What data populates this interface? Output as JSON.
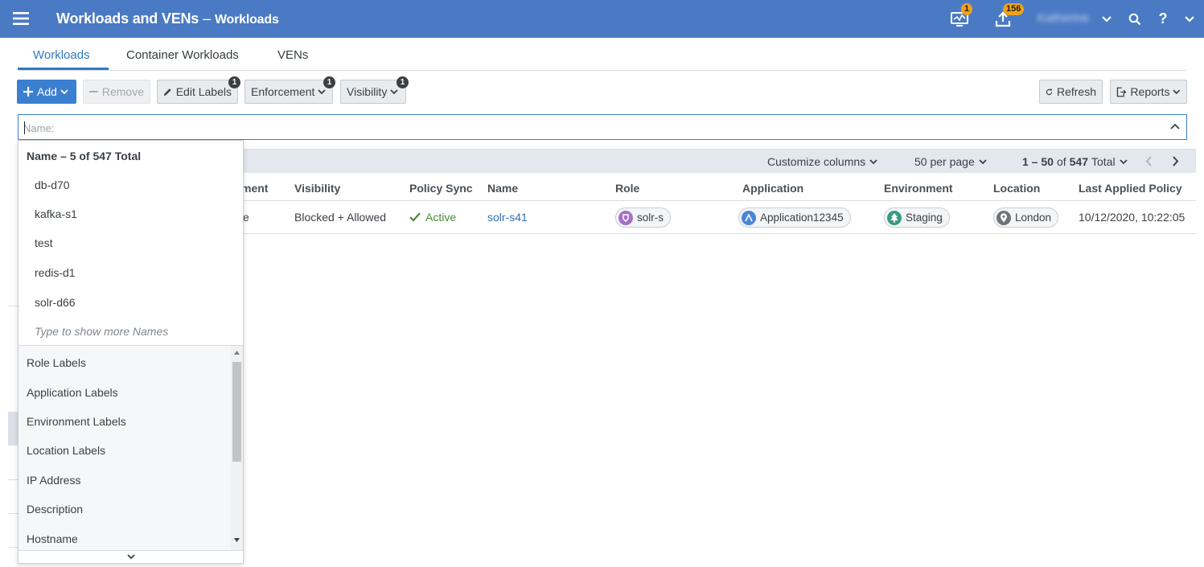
{
  "header": {
    "title": "Workloads and VENs",
    "separator": "–",
    "subtitle": "Workloads",
    "notifications_count": "1",
    "uploads_count": "156",
    "user_name": "Katherine"
  },
  "tabs": [
    {
      "label": "Workloads",
      "active": true
    },
    {
      "label": "Container Workloads"
    },
    {
      "label": "VENs"
    }
  ],
  "toolbar": {
    "add_label": "Add",
    "remove_label": "Remove",
    "edit_labels_label": "Edit Labels",
    "edit_labels_badge": "1",
    "enforcement_label": "Enforcement",
    "enforcement_badge": "1",
    "visibility_label": "Visibility",
    "visibility_badge": "1",
    "refresh_label": "Refresh",
    "reports_label": "Reports"
  },
  "search": {
    "placeholder": "Name:",
    "value": ""
  },
  "pagination": {
    "customize_label": "Customize columns",
    "per_page_label": "50 per page",
    "range": "1 – 50",
    "of_label": "of",
    "total": "547",
    "total_label": "Total"
  },
  "table": {
    "columns": [
      "ment",
      "Visibility",
      "Policy Sync",
      "Name",
      "Role",
      "Application",
      "Environment",
      "Location",
      "Last Applied Policy"
    ],
    "rows": [
      {
        "enforcement": "e",
        "visibility": "Blocked + Allowed",
        "policy_sync": "Active",
        "name": "solr-s41",
        "role": "solr-s",
        "application": "Application12345",
        "environment": "Staging",
        "location": "London",
        "last_applied": "10/12/2020, 10:22:05"
      }
    ]
  },
  "dropdown": {
    "title": "Name – 5 of 547 Total",
    "items": [
      "db-d70",
      "kafka-s1",
      "test",
      "redis-d1",
      "solr-d66"
    ],
    "hint": "Type to show more Names",
    "categories": [
      "Role Labels",
      "Application Labels",
      "Environment Labels",
      "Location Labels",
      "IP Address",
      "Description",
      "Hostname"
    ]
  },
  "colors": {
    "header_bg": "#4a7ac4",
    "primary": "#3b7fd0",
    "link": "#2f6fb3",
    "active_green": "#4b8a3a",
    "badge_orange": "#f0a21a",
    "role_icon": "#a570c8",
    "app_icon": "#4a86d4",
    "env_icon": "#3a9a86",
    "loc_icon": "#6e7379"
  }
}
